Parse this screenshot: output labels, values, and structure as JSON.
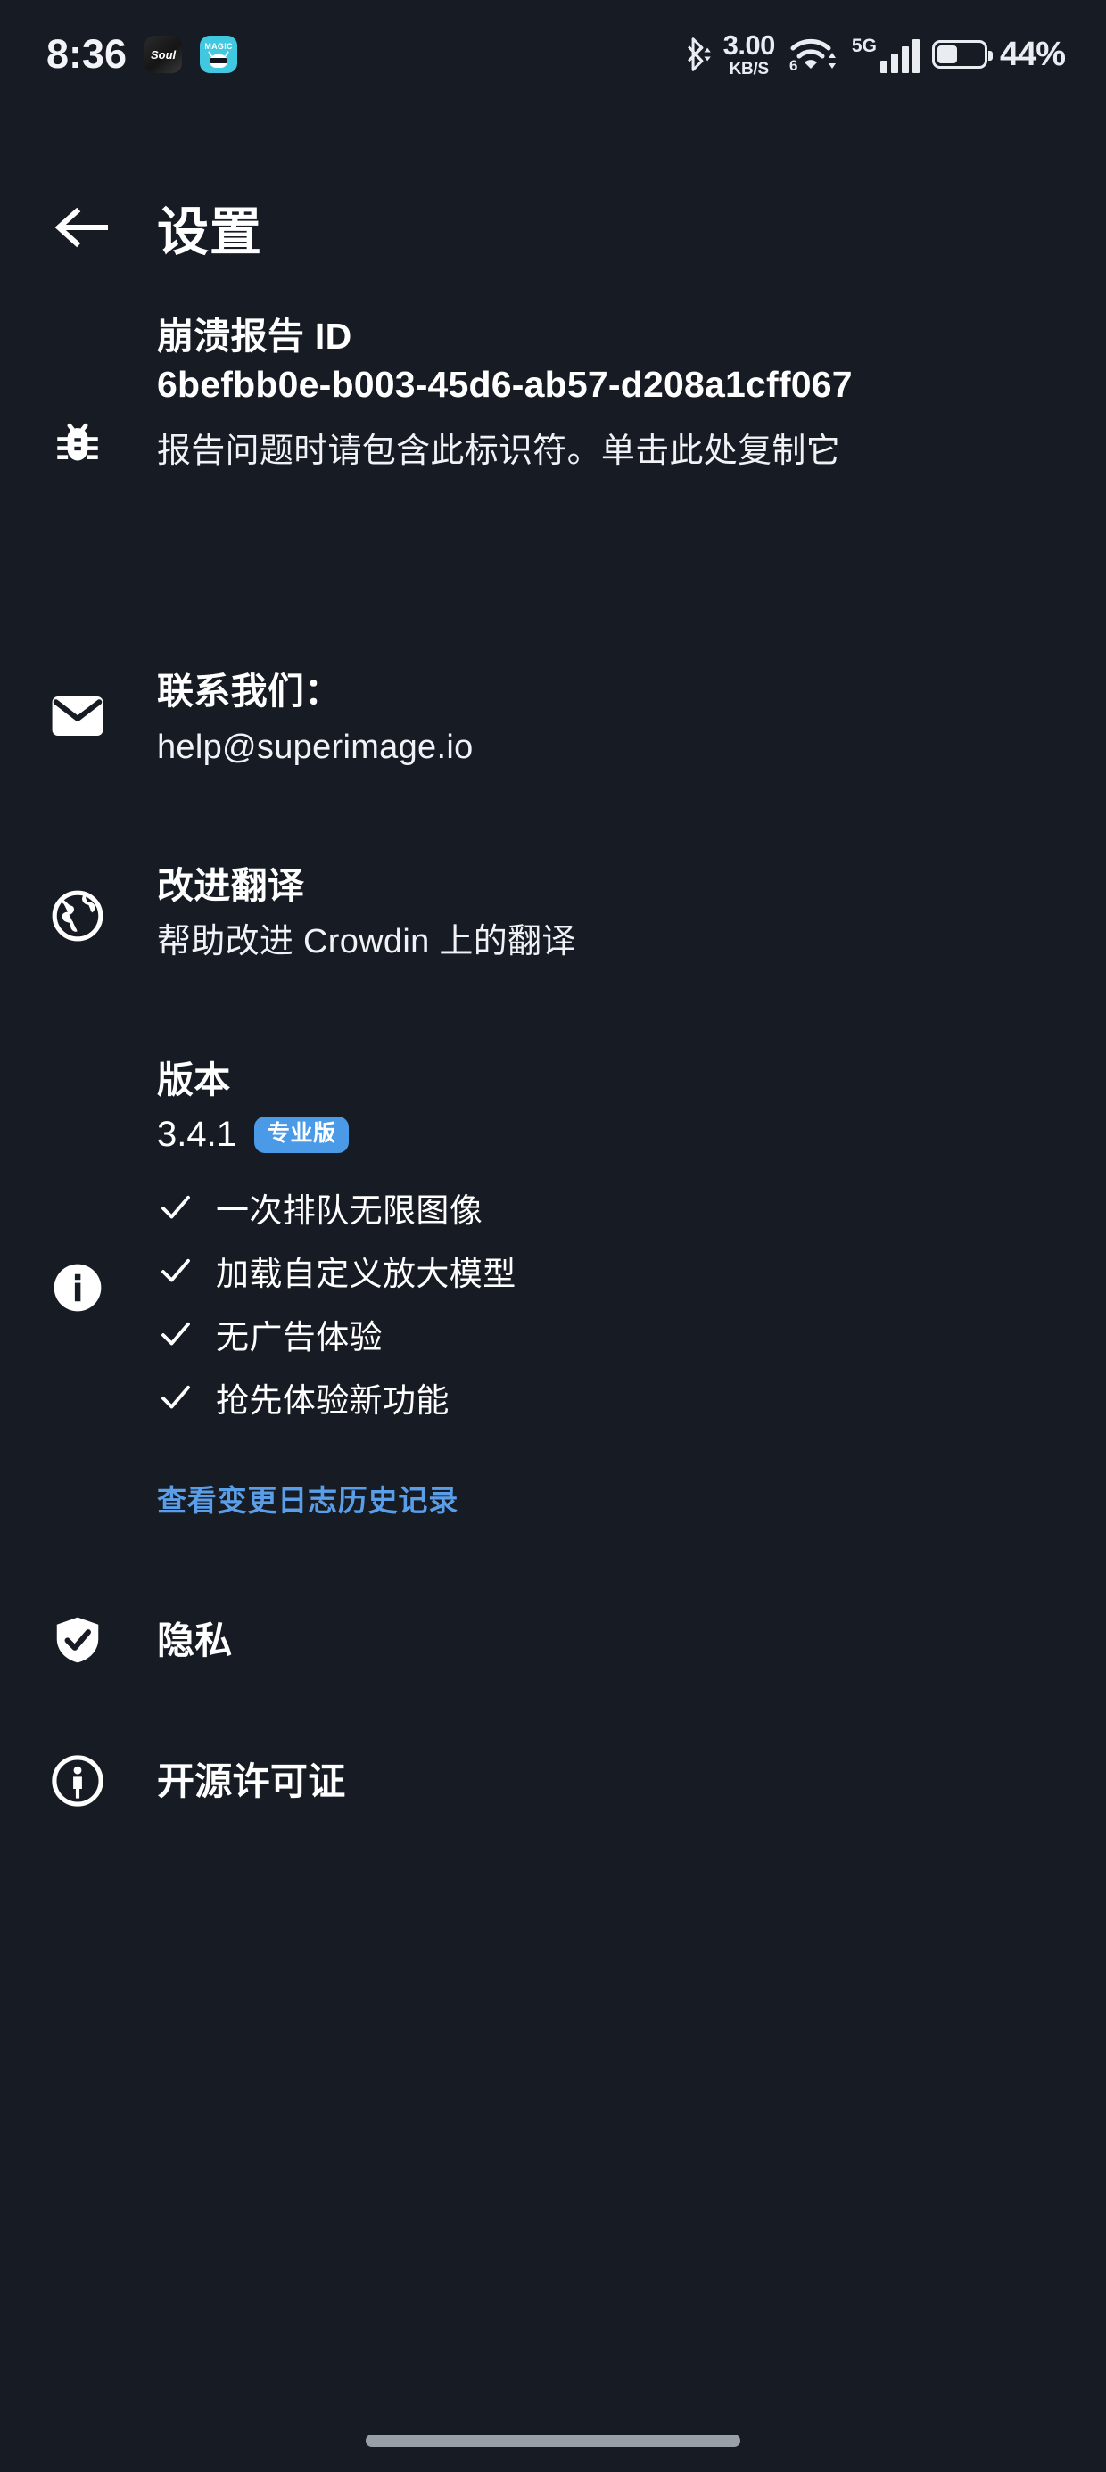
{
  "statusbar": {
    "time": "8:36",
    "app_icons": [
      {
        "name": "soul-app-icon",
        "label": "Soul"
      },
      {
        "name": "magic-app-icon",
        "label": "MAGIC"
      }
    ],
    "bluetooth_icon": "bluetooth-icon",
    "network_speed_value": "3.00",
    "network_speed_unit": "KB/S",
    "wifi_icon": "wifi-6-icon",
    "wifi_generation": "6",
    "mobile_network_label": "5G",
    "signal_icon": "signal-bars-icon",
    "battery_icon": "battery-icon",
    "battery_percent": "44%"
  },
  "appbar": {
    "back_icon": "back-arrow-icon",
    "title": "设置"
  },
  "sections": {
    "crash_report": {
      "icon": "bug-icon",
      "title": "崩溃报告 ID",
      "id_value": "6befbb0e-b003-45d6-ab57-d208a1cff067",
      "description": "报告问题时请包含此标识符。单击此处复制它"
    },
    "contact": {
      "icon": "mail-icon",
      "title": "联系我们：",
      "email": "help@superimage.io"
    },
    "translation": {
      "icon": "globe-icon",
      "title": "改进翻译",
      "subtitle": "帮助改进 Crowdin 上的翻译"
    },
    "version": {
      "icon": "info-circle-icon",
      "title": "版本",
      "number": "3.4.1",
      "badge": "专业版",
      "badge_color": "#4a9ae8",
      "features": [
        {
          "check_icon": "check-icon",
          "label": "一次排队无限图像"
        },
        {
          "check_icon": "check-icon",
          "label": "加载自定义放大模型"
        },
        {
          "check_icon": "check-icon",
          "label": "无广告体验"
        },
        {
          "check_icon": "check-icon",
          "label": "抢先体验新功能"
        }
      ],
      "changelog_link": "查看变更日志历史记录",
      "link_color": "#5a9ee8"
    },
    "privacy": {
      "icon": "shield-check-icon",
      "title": "隐私"
    },
    "licenses": {
      "icon": "open-source-icon",
      "title": "开源许可证"
    }
  },
  "system": {
    "home_indicator": "home-indicator"
  },
  "theme": {
    "background": "#161b24",
    "text": "#ffffff",
    "accent": "#4a9ae8"
  }
}
